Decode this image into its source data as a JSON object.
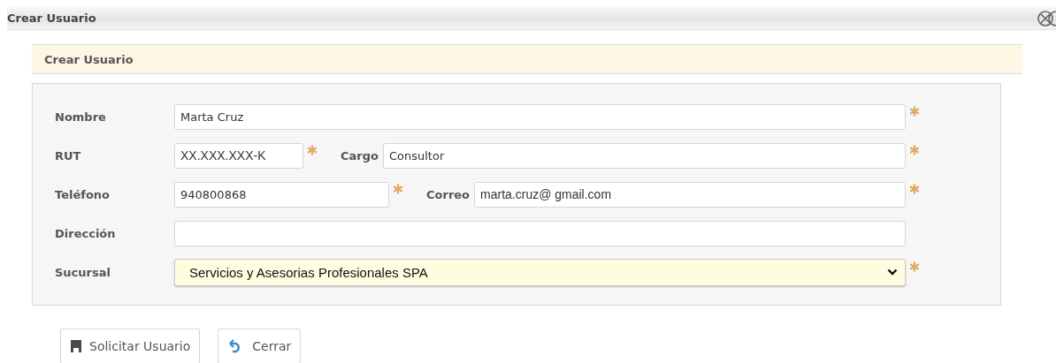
{
  "window": {
    "title": "Crear Usuario"
  },
  "panel": {
    "title": "Crear Usuario"
  },
  "rows": [
    {
      "fields": [
        {
          "label": "Nombre",
          "value": "Marta Cruz",
          "required": true,
          "kind": "text"
        }
      ]
    },
    {
      "fields": [
        {
          "label": "RUT",
          "value": "XX.XXX.XXX-K",
          "required": true,
          "kind": "text"
        },
        {
          "label": "Cargo",
          "value": "Consultor",
          "required": true,
          "kind": "text"
        }
      ]
    },
    {
      "fields": [
        {
          "label": "Teléfono",
          "value": "940800868",
          "required": true,
          "kind": "text"
        },
        {
          "label": "Correo",
          "value": "marta.cruz@ gmail.com",
          "required": true,
          "kind": "text"
        }
      ]
    },
    {
      "fields": [
        {
          "label": "Dirección",
          "required": false,
          "kind": "text"
        }
      ]
    },
    {
      "fields": [
        {
          "label": "Sucursal",
          "value": "Servicios y Asesorias Profesionales SPA",
          "required": true,
          "kind": "select"
        }
      ]
    }
  ],
  "buttons": [
    {
      "label": "Solicitar Usuario",
      "kind": "save"
    },
    {
      "label": "Cerrar",
      "kind": "close"
    }
  ]
}
